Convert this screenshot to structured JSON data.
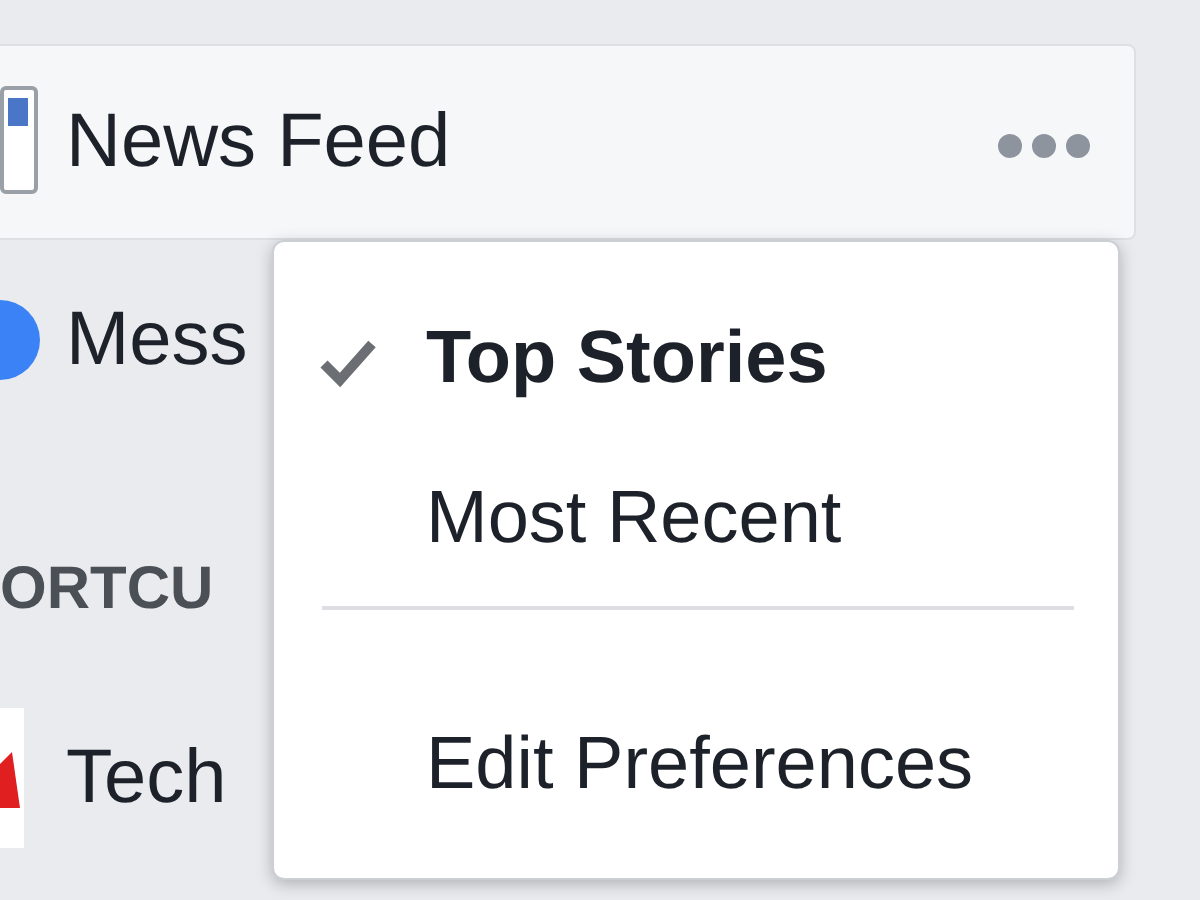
{
  "sidebar": {
    "items": [
      {
        "label": "News Feed",
        "selected": true
      },
      {
        "label": "Mess",
        "selected": false
      }
    ],
    "section_title": "ORTCU",
    "shortcuts": [
      {
        "label": "Tech"
      }
    ]
  },
  "menu": {
    "options": [
      {
        "label": "Top Stories",
        "selected": true
      },
      {
        "label": "Most Recent",
        "selected": false
      }
    ],
    "actions": [
      "Edit Preferences"
    ]
  }
}
